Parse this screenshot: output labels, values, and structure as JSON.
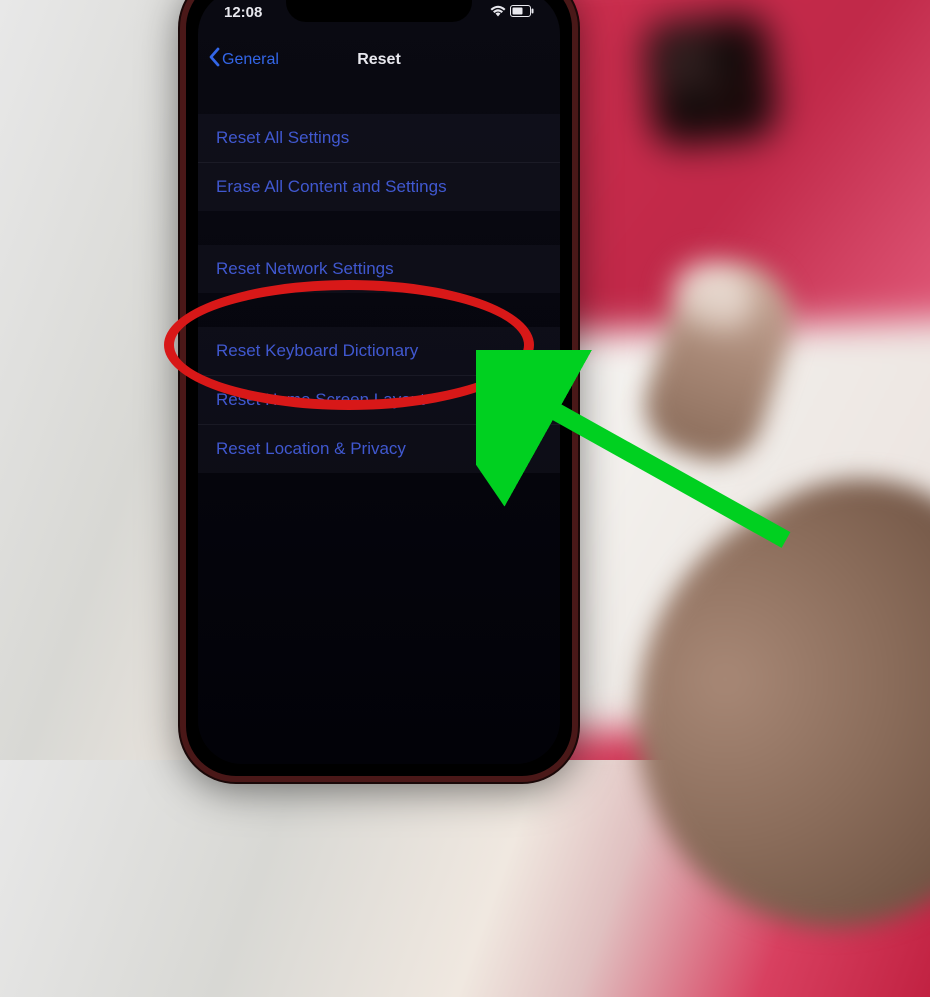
{
  "status": {
    "time": "12:08"
  },
  "nav": {
    "back_label": "General",
    "title": "Reset"
  },
  "menu": {
    "group1": [
      {
        "label": "Reset All Settings"
      },
      {
        "label": "Erase All Content and Settings"
      }
    ],
    "group2": [
      {
        "label": "Reset Network Settings"
      }
    ],
    "group3": [
      {
        "label": "Reset Keyboard Dictionary"
      },
      {
        "label": "Reset Home Screen Layout"
      },
      {
        "label": "Reset Location & Privacy"
      }
    ]
  },
  "annotation": {
    "highlight_color": "#d81818",
    "arrow_color": "#00d020"
  }
}
